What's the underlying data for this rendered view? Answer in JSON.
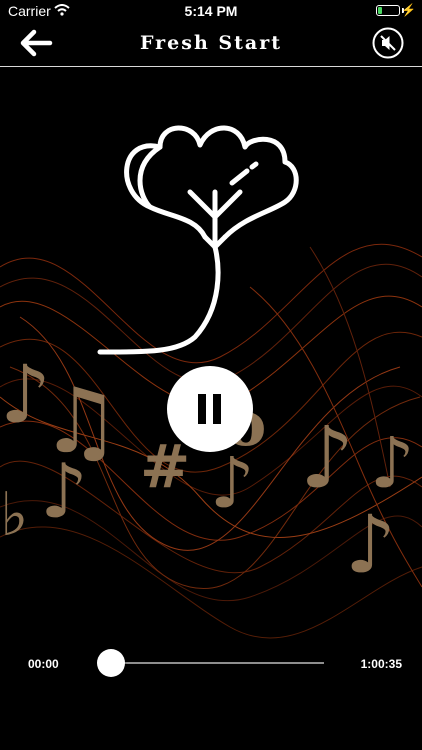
{
  "status": {
    "carrier": "Carrier",
    "time": "5:14 PM",
    "battery_level": 0.2
  },
  "nav": {
    "title": "Fresh Start",
    "back_icon": "arrow-left-icon",
    "mute_icon": "speaker-muted-icon"
  },
  "player": {
    "state": "playing",
    "current_time": "00:00",
    "duration": "1:00:35",
    "progress": 0.0
  },
  "colors": {
    "background": "#000000",
    "wave": "#8a2a0a",
    "notes": "#8c7253",
    "accent": "#ffffff"
  }
}
